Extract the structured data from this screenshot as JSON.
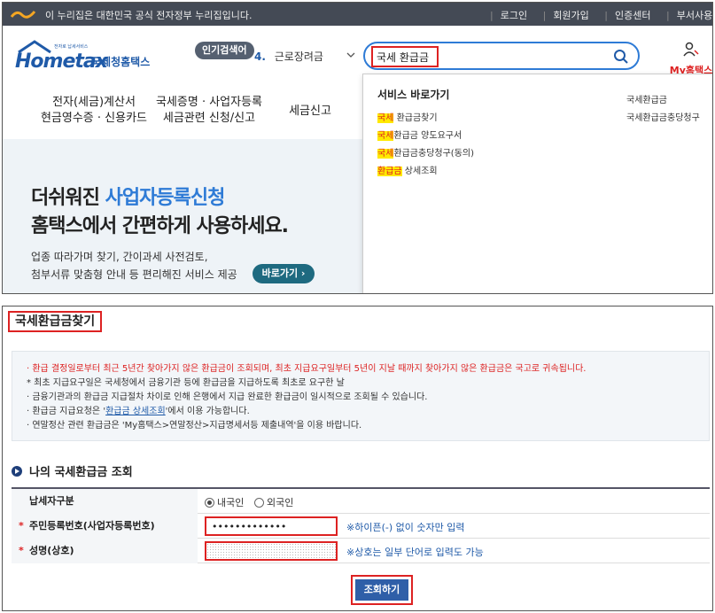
{
  "gov_bar": {
    "text": "이 누리집은 대한민국 공식 전자정부 누리집입니다.",
    "links": [
      "로그인",
      "회원가입",
      "인증센터",
      "부서사용자 가입하기"
    ]
  },
  "header": {
    "logo_text": "Hometax",
    "logo_small": "전자로 납세서비스",
    "logo_org": "국세청홈택스",
    "popular_badge": "인기검색어",
    "popular_rank": "4.",
    "popular_term": "근로장려금",
    "search_value": "국세 환급금",
    "my_label": "My홈택스"
  },
  "nav": [
    {
      "line1": "전자(세금)계산서",
      "line2": "현금영수증 · 신용카드"
    },
    {
      "line1": "국세증명 · 사업자등록",
      "line2": "세금관련 신청/신고"
    },
    {
      "line1": "세금신고",
      "line2": ""
    }
  ],
  "banner": {
    "headline_a": "더쉬워진 ",
    "headline_b": "사업자등록신청",
    "headline2": "홈택스에서 간편하게 사용하세요.",
    "desc1": "업종 따라가며 찾기, 간이과세 사전검토,",
    "desc2": "첨부서류 맞춤형 안내 등 편리해진 서비스 제공",
    "button": "바로가기 ›"
  },
  "dropdown": {
    "title": "서비스 바로가기",
    "items": [
      {
        "hl": "국세",
        "rest": " 환급금찾기"
      },
      {
        "hl": "국세",
        "rest": "환급금 양도요구서"
      },
      {
        "hl": "국세",
        "rest": "환급금충당청구(동의)"
      },
      {
        "hl": "환급금",
        "rest": " 상세조회"
      }
    ],
    "right_items": [
      "국세환급금",
      "국세환급금충당청구"
    ]
  },
  "page": {
    "title": "국세환급금찾기",
    "notices": [
      "· 환급 결정일로부터 최근 5년간 찾아가지 않은 환급금이 조회되며, 최초 지급요구일부터 5년이 지날 때까지 찾아가지 않은 환급금은 국고로 귀속됩니다.",
      "  * 최초 지급요구일은 국세청에서 금융기관 등에 환급금을 지급하도록 최초로 요구한 날",
      "· 금융기관과의 환급금 지급절차 차이로 인해 은행에서 지급 완료한 환급금이 일시적으로 조회될 수 있습니다.",
      "· 환급금 지급요청은 '",
      "· 연말정산 관련 환급금은 'My홈택스>연말정산>지급명세서등 제출내역'을 이용 바랍니다."
    ],
    "notice4_link": "환급금 상세조회",
    "notice4_tail": "'에서 이용 가능합니다.",
    "section_title": "나의 국세환급금 조회",
    "form": {
      "taxpayer_type_label": "납세자구분",
      "domestic": "내국인",
      "foreign": "외국인",
      "rrn_label": "주민등록번호(사업자등록번호)",
      "rrn_value": "•••••••••••••",
      "rrn_hint": "※하이픈(-) 없이 숫자만 입력",
      "name_label": "성명(상호)",
      "name_value": "",
      "name_hint": "※상호는 일부 단어로 입력도 가능",
      "required_mark": "*"
    },
    "submit": "조회하기"
  },
  "colors": {
    "accent_blue": "#2e7bd6",
    "highlight_red": "#dd2222",
    "highlight_yellow": "#ffe900",
    "button_blue": "#2f5fa8"
  }
}
